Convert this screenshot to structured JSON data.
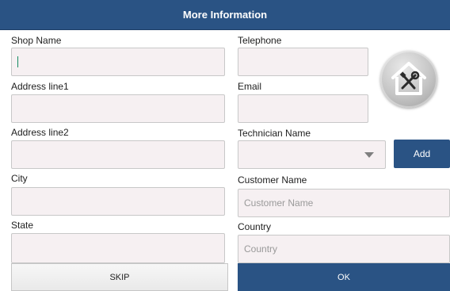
{
  "title": "More Information",
  "form": {
    "shop_name": {
      "label": "Shop Name",
      "value": ""
    },
    "address_line1": {
      "label": "Address line1",
      "value": ""
    },
    "address_line2": {
      "label": "Address line2",
      "value": ""
    },
    "city": {
      "label": "City",
      "value": ""
    },
    "state": {
      "label": "State",
      "value": ""
    },
    "telephone": {
      "label": "Telephone",
      "value": ""
    },
    "email": {
      "label": "Email",
      "value": ""
    },
    "technician_name": {
      "label": "Technician Name",
      "selected": ""
    },
    "customer_name": {
      "label": "Customer Name",
      "placeholder": "Customer Name"
    },
    "country": {
      "label": "Country",
      "placeholder": "Country"
    }
  },
  "buttons": {
    "add": "Add",
    "skip": "SKIP",
    "ok": "OK"
  },
  "icons": {
    "badge": "house-tools-icon",
    "dropdown": "caret-down-icon"
  },
  "colors": {
    "accent": "#2a5384",
    "field_bg": "#f6f0f2"
  }
}
